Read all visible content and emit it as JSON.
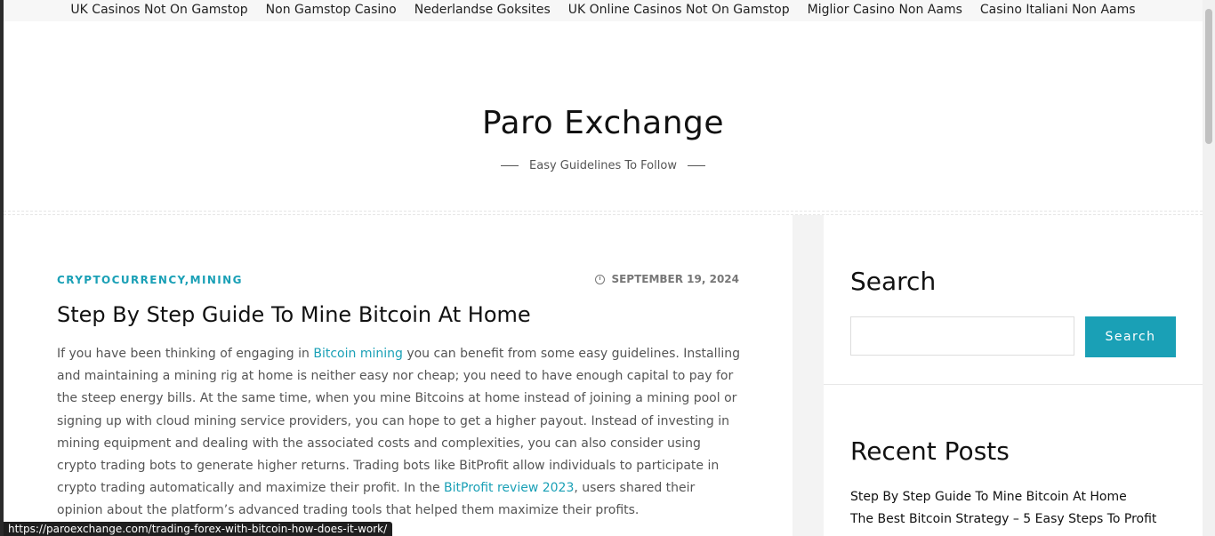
{
  "topnav": {
    "links": [
      "UK Casinos Not On Gamstop",
      "Non Gamstop Casino",
      "Nederlandse Goksites",
      "UK Online Casinos Not On Gamstop",
      "Miglior Casino Non Aams",
      "Casino Italiani Non Aams"
    ]
  },
  "header": {
    "site_title": "Paro Exchange",
    "tagline": "Easy Guidelines To Follow"
  },
  "post": {
    "categories": [
      "CRYPTOCURRENCY",
      "MINING"
    ],
    "category_separator": ",",
    "date": "SEPTEMBER 19, 2024",
    "title": "Step By Step Guide To Mine Bitcoin At Home",
    "excerpt": {
      "p1": "If you have been thinking of engaging in ",
      "link1": "Bitcoin mining",
      "p2": " you can benefit from some easy guidelines. Installing and maintaining a mining rig at home is neither easy nor cheap; you need to have enough capital to pay for the steep energy bills. At the same time, when you mine Bitcoins at home instead of joining a mining pool or signing up with cloud mining service providers, you can hope to get a higher payout. Instead of investing in mining equipment and dealing with the associated costs and complexities, you can also consider using crypto trading bots to generate higher returns. Trading bots like BitProfit allow individuals to participate in crypto trading automatically and maximize their profit. In the ",
      "link2": "BitProfit review 2023",
      "p3": ", users shared their opinion about the platform’s advanced trading tools that helped them maximize their profits."
    }
  },
  "sidebar": {
    "search_title": "Search",
    "search_placeholder": "",
    "search_button": "Search",
    "recent_title": "Recent Posts",
    "recent_posts": [
      "Step By Step Guide To Mine Bitcoin At Home",
      "The Best Bitcoin Strategy – 5 Easy Steps To Profit"
    ]
  },
  "status_bar": {
    "url": "https://paroexchange.com/trading-forex-with-bitcoin-how-does-it-work/"
  },
  "colors": {
    "accent": "#1aa0b6",
    "text": "#111111",
    "muted": "#555555"
  }
}
